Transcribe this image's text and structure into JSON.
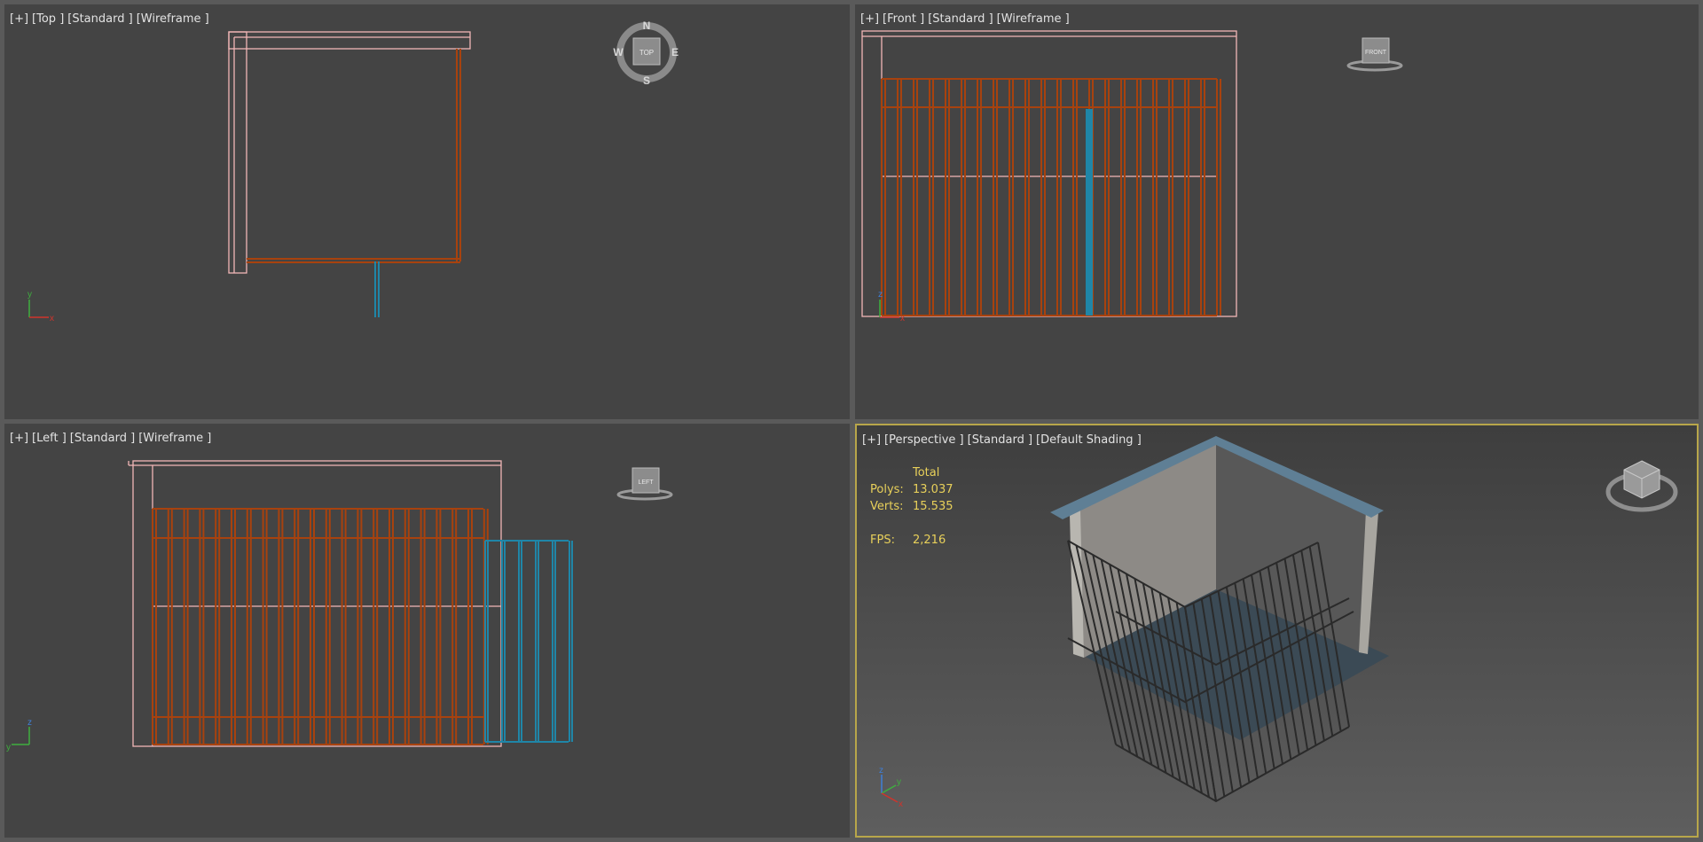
{
  "viewports": {
    "top": {
      "labels": [
        "[+]",
        "[Top ]",
        "[Standard ]",
        "[Wireframe ]"
      ],
      "cube": "TOP",
      "compass": {
        "n": "N",
        "s": "S",
        "w": "W",
        "e": "E"
      },
      "axes": {
        "a": "y",
        "b": "x"
      }
    },
    "front": {
      "labels": [
        "[+]",
        "[Front ]",
        "[Standard ]",
        "[Wireframe ]"
      ],
      "cube": "FRONT",
      "axes": {
        "a": "z",
        "b": "x"
      }
    },
    "left": {
      "labels": [
        "[+]",
        "[Left ]",
        "[Standard ]",
        "[Wireframe ]"
      ],
      "cube": "LEFT",
      "axes": {
        "a": "z",
        "b": "y"
      }
    },
    "perspective": {
      "labels": [
        "[+]",
        "[Perspective ]",
        "[Standard ]",
        "[Default Shading ]"
      ],
      "axes": {
        "a": "z",
        "b": "y",
        "c": "x"
      }
    }
  },
  "stats": {
    "header": "Total",
    "polys_label": "Polys:",
    "polys": "13.037",
    "verts_label": "Verts:",
    "verts": "15.535",
    "fps_label": "FPS:",
    "fps": "2,216"
  },
  "colors": {
    "viewport_bg": "#444444",
    "wall_wire": "#f2b6b6",
    "frame": "#a8420e",
    "gate": "#1f86a8",
    "active_border": "#b8a64a",
    "stats_text": "#e8d05a"
  }
}
